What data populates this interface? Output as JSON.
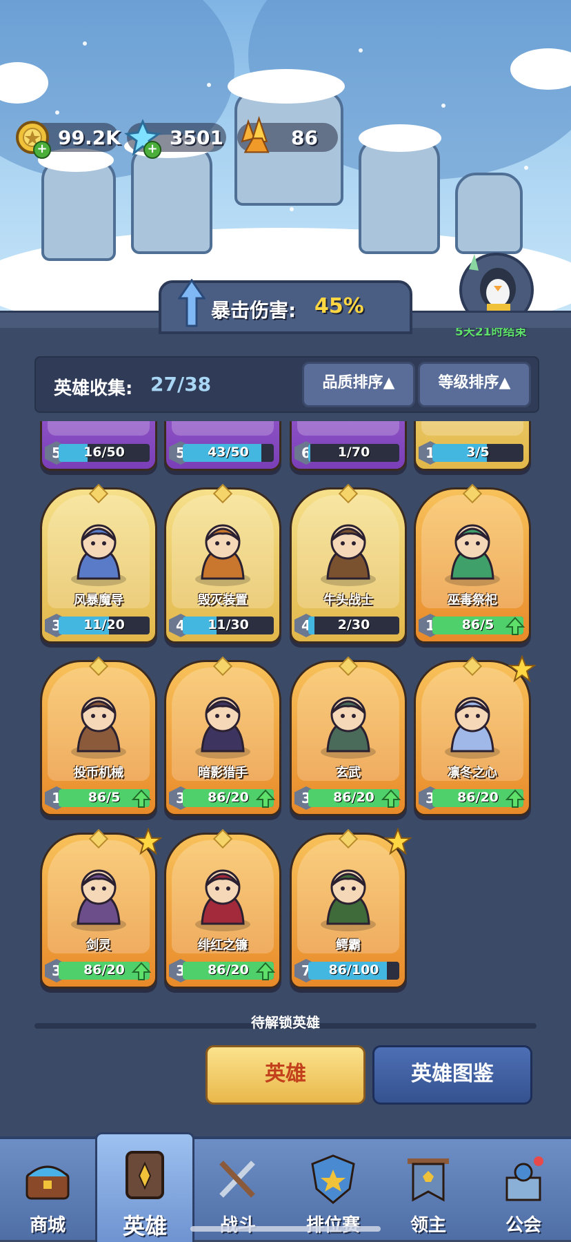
{
  "resources": [
    {
      "name": "gold-coin-icon",
      "value": "99.2K"
    },
    {
      "name": "ice-crystal-icon",
      "value": "3501"
    },
    {
      "name": "amber-crystal-icon",
      "value": "86"
    }
  ],
  "crit": {
    "label": "暴击伤害:",
    "value": "45%"
  },
  "event": {
    "countdown": "5天21时结束"
  },
  "collection": {
    "label": "英雄收集:",
    "value": "27/38"
  },
  "sort": {
    "quality": "品质排序▲",
    "level": "等级排序▲"
  },
  "heroes_partial": [
    {
      "level": "5",
      "progress": "16/50",
      "fill": 0.32,
      "rarity": "purple"
    },
    {
      "level": "5",
      "progress": "43/50",
      "fill": 0.86,
      "rarity": "purple"
    },
    {
      "level": "6",
      "progress": "1/70",
      "fill": 0.02,
      "rarity": "purple"
    },
    {
      "level": "1",
      "progress": "3/5",
      "fill": 0.6,
      "rarity": "gold"
    }
  ],
  "heroes": [
    {
      "name": "风暴魔导",
      "level": "3",
      "progress": "11/20",
      "fill": 0.55,
      "rarity": "gold",
      "upgradable": false,
      "starred": false,
      "icon": "wizard-icon"
    },
    {
      "name": "毁灭装置",
      "level": "4",
      "progress": "11/30",
      "fill": 0.37,
      "rarity": "gold",
      "upgradable": false,
      "starred": false,
      "icon": "cannon-robot-icon"
    },
    {
      "name": "牛头战士",
      "level": "4",
      "progress": "2/30",
      "fill": 0.07,
      "rarity": "gold",
      "upgradable": false,
      "starred": false,
      "icon": "minotaur-icon"
    },
    {
      "name": "巫毒祭祀",
      "level": "1",
      "progress": "86/5",
      "fill": 1,
      "rarity": "orange",
      "upgradable": true,
      "starred": false,
      "icon": "snake-priestess-icon"
    },
    {
      "name": "投币机械",
      "level": "1",
      "progress": "86/5",
      "fill": 1,
      "rarity": "orange",
      "upgradable": true,
      "starred": false,
      "icon": "slot-machine-icon"
    },
    {
      "name": "暗影猎手",
      "level": "3",
      "progress": "86/20",
      "fill": 1,
      "rarity": "orange",
      "upgradable": true,
      "starred": false,
      "icon": "hooded-hunter-icon"
    },
    {
      "name": "玄武",
      "level": "3",
      "progress": "86/20",
      "fill": 1,
      "rarity": "orange",
      "upgradable": true,
      "starred": false,
      "icon": "turtle-dragon-icon"
    },
    {
      "name": "凛冬之心",
      "level": "3",
      "progress": "86/20",
      "fill": 1,
      "rarity": "orange",
      "upgradable": true,
      "starred": true,
      "icon": "ice-queen-icon"
    },
    {
      "name": "剑灵",
      "level": "3",
      "progress": "86/20",
      "fill": 1,
      "rarity": "orange",
      "upgradable": true,
      "starred": true,
      "icon": "sword-spirit-icon"
    },
    {
      "name": "绯红之镰",
      "level": "3",
      "progress": "86/20",
      "fill": 1,
      "rarity": "orange",
      "upgradable": true,
      "starred": false,
      "icon": "crimson-scythe-icon"
    },
    {
      "name": "鳄霸",
      "level": "7",
      "progress": "86/100",
      "fill": 0.86,
      "rarity": "orange",
      "upgradable": false,
      "starred": true,
      "icon": "crocodile-brute-icon"
    }
  ],
  "locked_label": "待解锁英雄",
  "buttons": {
    "hero": "英雄",
    "codex": "英雄图鉴"
  },
  "tabs": [
    {
      "label": "商城",
      "icon": "treasure-chest-icon"
    },
    {
      "label": "英雄",
      "icon": "hero-card-icon",
      "active": true
    },
    {
      "label": "战斗",
      "icon": "crossed-swords-icon"
    },
    {
      "label": "排位赛",
      "icon": "rank-shield-icon"
    },
    {
      "label": "领主",
      "icon": "banner-icon"
    },
    {
      "label": "公会",
      "icon": "guild-castle-icon"
    }
  ],
  "colors": {
    "accent_gold": "#ffd743",
    "event_green": "#5ee06a",
    "progress_blue": "#44b7e0",
    "progress_green": "#4fd06b"
  }
}
